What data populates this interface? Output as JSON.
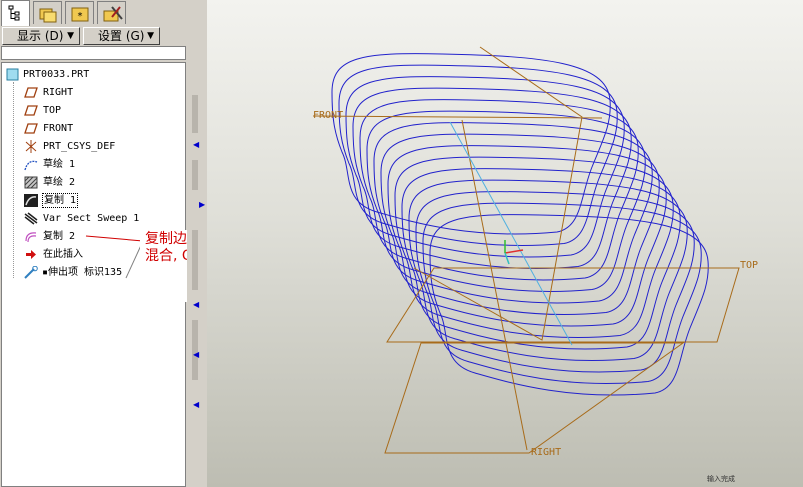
{
  "toolbar": {
    "show_menu": "显示 (D)",
    "settings_menu": "设置 (G)"
  },
  "tree": {
    "root": "PRT0033.PRT",
    "items": [
      {
        "label": "RIGHT",
        "icon": "datum-plane-icon"
      },
      {
        "label": "TOP",
        "icon": "datum-plane-icon"
      },
      {
        "label": "FRONT",
        "icon": "datum-plane-icon"
      },
      {
        "label": "PRT_CSYS_DEF",
        "icon": "coordinate-system-icon"
      },
      {
        "label": "草绘 1",
        "icon": "sketch-icon"
      },
      {
        "label": "草绘 2",
        "icon": "sketch-hatched-icon"
      },
      {
        "label": "复制 1",
        "icon": "copy-feature-icon"
      },
      {
        "label": "Var Sect Sweep 1",
        "icon": "sweep-icon"
      },
      {
        "label": "复制 2",
        "icon": "copy-surface-icon"
      },
      {
        "label": "在此插入",
        "icon": "insert-here-arrow-icon"
      },
      {
        "label": "▪伸出项 标识135",
        "icon": "protrusion-icon"
      }
    ]
  },
  "annotation": {
    "line1": "复制边, 扫描",
    "line2": "混合, OK",
    "color": "#d00000"
  },
  "viewport": {
    "plane_labels": {
      "front": "FRONT",
      "top": "TOP",
      "right": "RIGHT"
    },
    "curve_color": "#2222cc",
    "plane_color": "#a86b1a",
    "status_text": "输入完成"
  }
}
